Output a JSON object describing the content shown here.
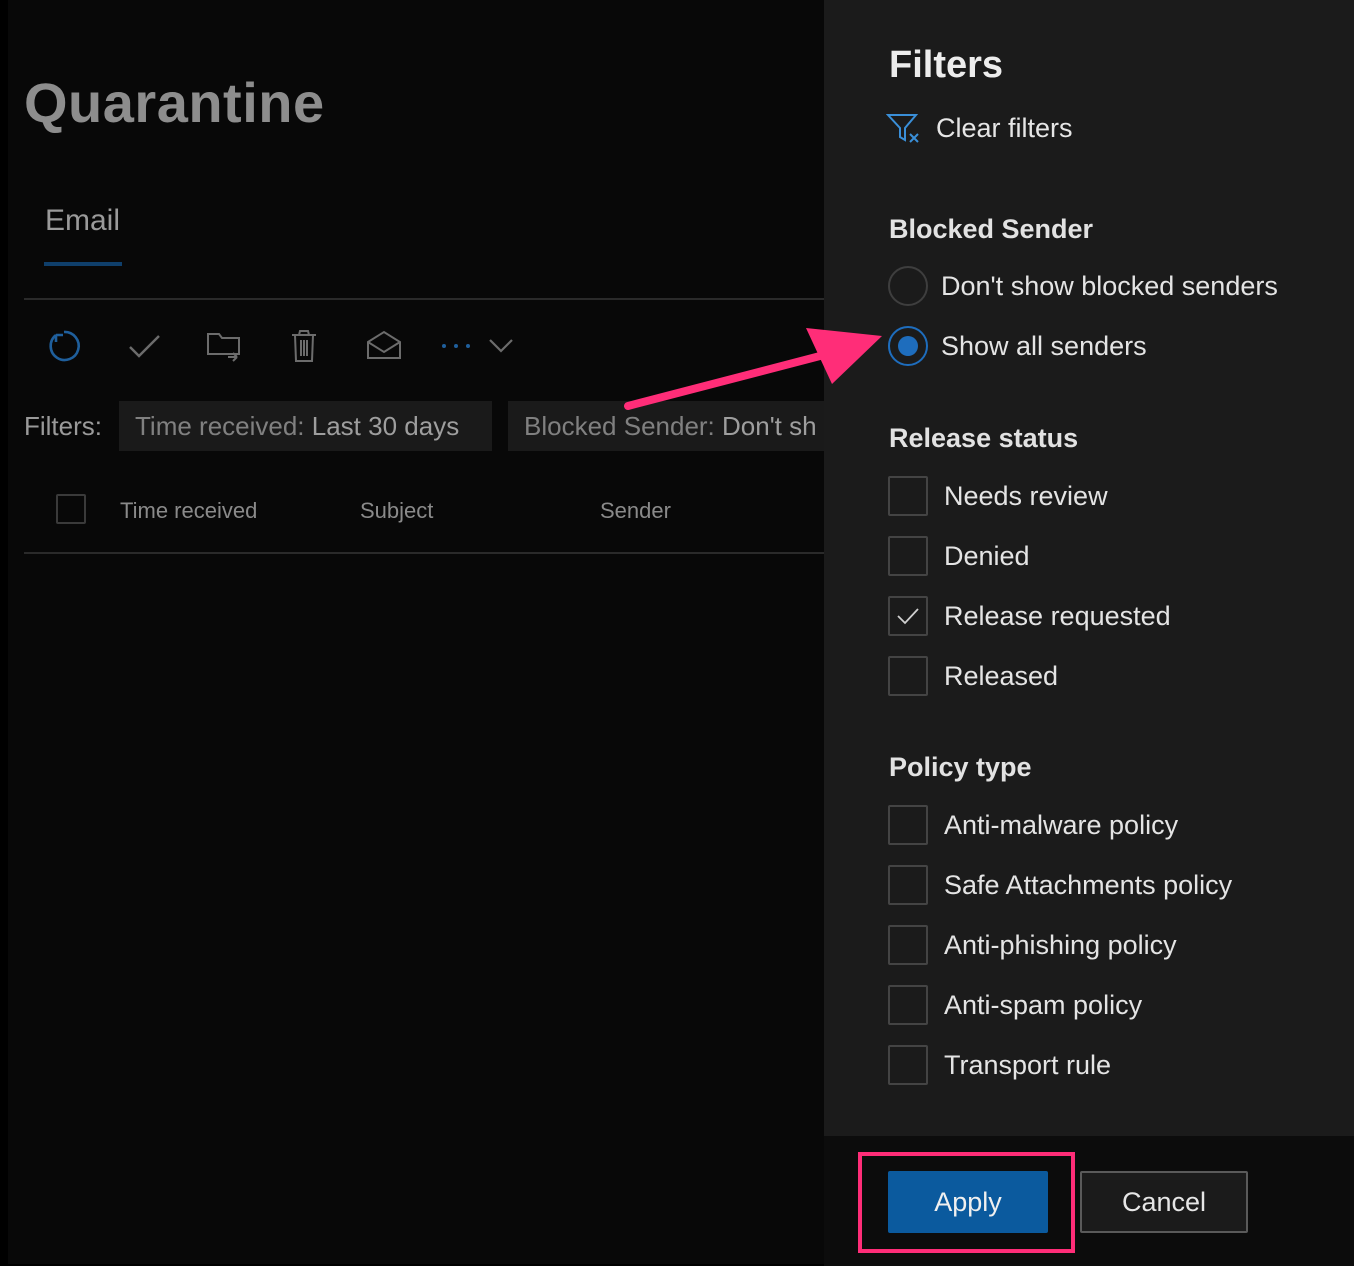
{
  "page": {
    "title": "Quarantine"
  },
  "tabs": [
    {
      "label": "Email",
      "selected": true
    }
  ],
  "toolbar": {
    "icons": [
      "refresh-icon",
      "checkmark-icon",
      "folder-move-icon",
      "trash-icon",
      "envelope-open-icon",
      "more-icon",
      "chevron-down-icon"
    ]
  },
  "filters_bar": {
    "label": "Filters:",
    "chips": [
      {
        "name": "Time received: ",
        "value": "Last 30 days"
      },
      {
        "name": "Blocked Sender: ",
        "value": "Don't sh"
      }
    ]
  },
  "table": {
    "columns": [
      "Time received",
      "Subject",
      "Sender"
    ]
  },
  "panel": {
    "title": "Filters",
    "clear_filters": "Clear filters",
    "blocked_sender": {
      "title": "Blocked Sender",
      "options": [
        {
          "label": "Don't show blocked senders",
          "selected": false
        },
        {
          "label": "Show all senders",
          "selected": true
        }
      ]
    },
    "release_status": {
      "title": "Release status",
      "options": [
        {
          "label": "Needs review",
          "checked": false
        },
        {
          "label": "Denied",
          "checked": false
        },
        {
          "label": "Release requested",
          "checked": true
        },
        {
          "label": "Released",
          "checked": false
        }
      ]
    },
    "policy_type": {
      "title": "Policy type",
      "options": [
        {
          "label": "Anti-malware policy",
          "checked": false
        },
        {
          "label": "Safe Attachments policy",
          "checked": false
        },
        {
          "label": "Anti-phishing policy",
          "checked": false
        },
        {
          "label": "Anti-spam policy",
          "checked": false
        },
        {
          "label": "Transport rule",
          "checked": false
        }
      ]
    },
    "buttons": {
      "apply": "Apply",
      "cancel": "Cancel"
    }
  },
  "colors": {
    "accent": "#1e6dbd",
    "primary_button": "#0b5a9e",
    "annotation": "#ff2d78"
  }
}
